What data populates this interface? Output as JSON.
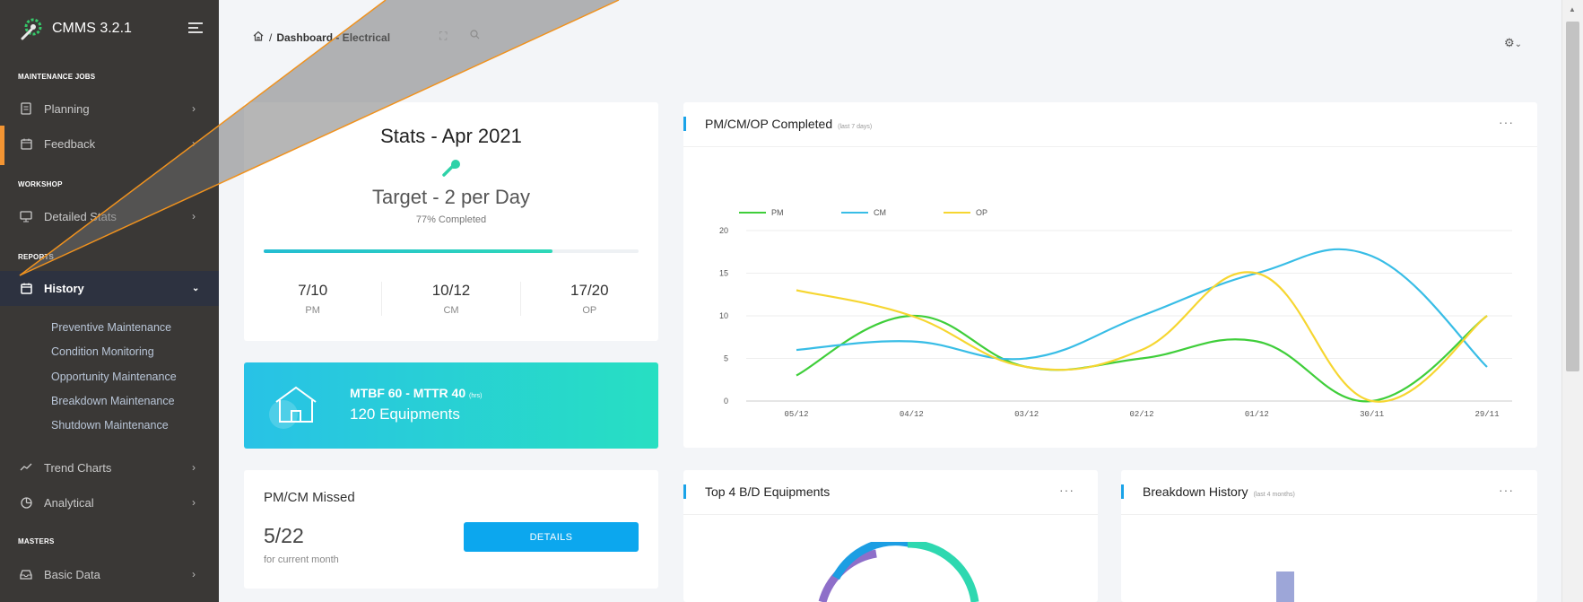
{
  "app": {
    "name": "CMMS 3.2.1"
  },
  "sidebar": {
    "sections": {
      "maintenance_jobs": "MAINTENANCE JOBS",
      "workshop": "WORKSHOP",
      "reports": "REPORTS",
      "masters": "MASTERS"
    },
    "items": {
      "planning": "Planning",
      "feedback": "Feedback",
      "detailed_stats": "Detailed Stats",
      "history": "History",
      "trend_charts": "Trend Charts",
      "analytical": "Analytical",
      "basic_data": "Basic Data"
    },
    "history_sub": [
      "Preventive Maintenance",
      "Condition Monitoring",
      "Opportunity Maintenance",
      "Breakdown Maintenance",
      "Shutdown Maintenance"
    ]
  },
  "header": {
    "breadcrumb_sep": "/",
    "breadcrumb_page": "Dashboard - Electrical"
  },
  "stats": {
    "title": "Stats - Apr 2021",
    "target": "Target - 2 per Day",
    "completed_label": "77% Completed",
    "progress": 0.77,
    "pm_val": "7/10",
    "pm_label": "PM",
    "cm_val": "10/12",
    "cm_label": "CM",
    "op_val": "17/20",
    "op_label": "OP"
  },
  "mtbf": {
    "line1": "MTBF 60 - MTTR 40",
    "unit": "(hrs)",
    "line2": "120 Equipments"
  },
  "missed": {
    "title": "PM/CM Missed",
    "value": "5/22",
    "sub": "for current month",
    "button": "DETAILS"
  },
  "completed_chart": {
    "title": "PM/CM/OP Completed",
    "subtitle": "(last 7 days)"
  },
  "top4": {
    "title": "Top 4 B/D Equipments"
  },
  "bdh": {
    "title": "Breakdown History",
    "subtitle": "(last 4 months)"
  },
  "chart_data": {
    "type": "line",
    "categories": [
      "05/12",
      "04/12",
      "03/12",
      "02/12",
      "01/12",
      "30/11",
      "29/11"
    ],
    "ylim": [
      0,
      20
    ],
    "yticks": [
      0,
      5,
      10,
      15,
      20
    ],
    "legend_position": "top-left",
    "grid": true,
    "series": [
      {
        "name": "PM",
        "color": "#3fce3a",
        "values": [
          3,
          10,
          4,
          5,
          7,
          0,
          10
        ]
      },
      {
        "name": "CM",
        "color": "#38bde6",
        "values": [
          6,
          7,
          5,
          10,
          15,
          17,
          4
        ]
      },
      {
        "name": "OP",
        "color": "#f6d631",
        "values": [
          13,
          10,
          4,
          6,
          15,
          0,
          10
        ]
      }
    ]
  }
}
